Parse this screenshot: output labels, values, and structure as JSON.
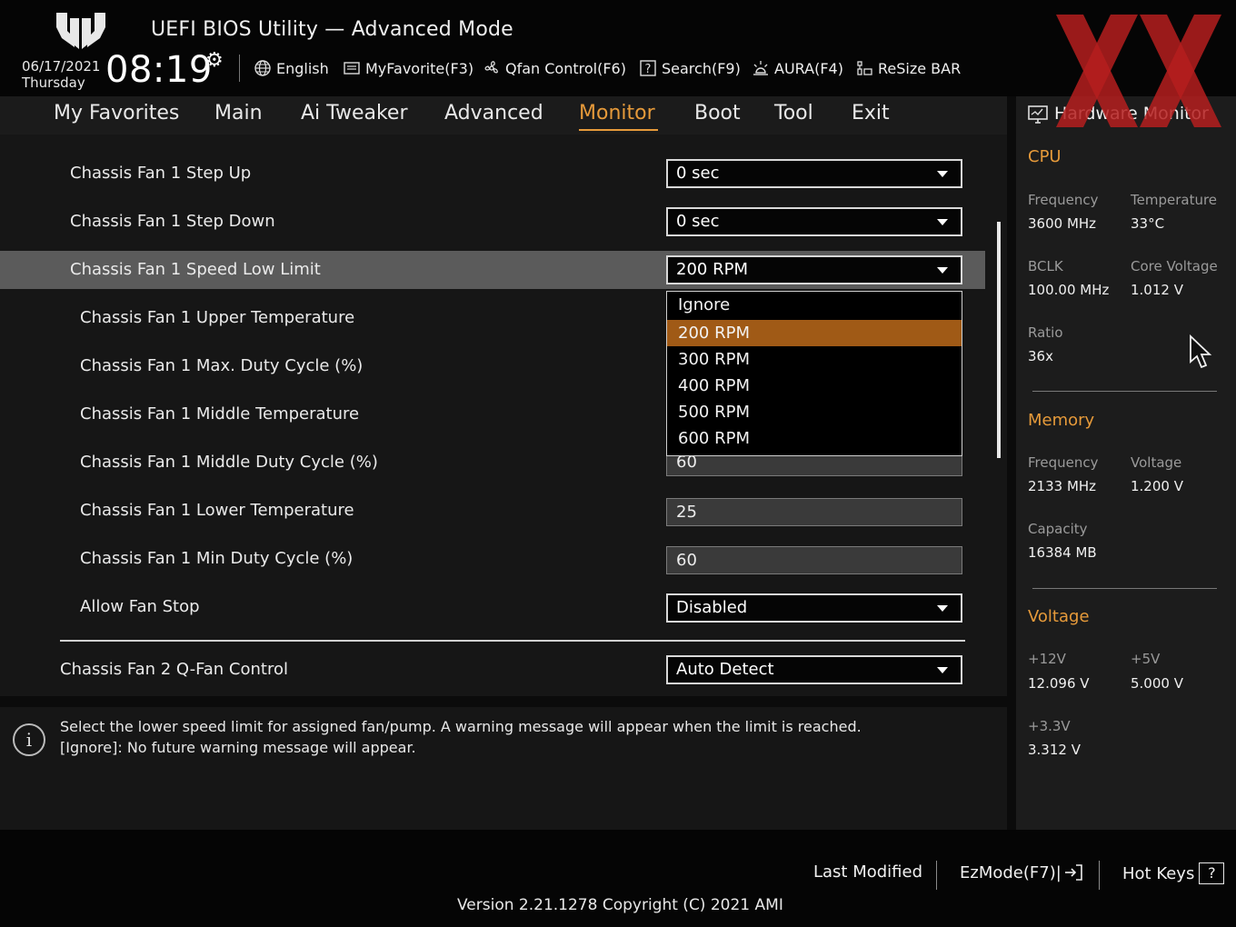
{
  "header": {
    "title": "UEFI BIOS Utility — Advanced Mode",
    "date": "06/17/2021",
    "day": "Thursday",
    "time": "08:19",
    "tools": [
      {
        "label": "English",
        "icon": "globe-icon"
      },
      {
        "label": "MyFavorite(F3)",
        "icon": "favorite-icon"
      },
      {
        "label": "Qfan Control(F6)",
        "icon": "fan-icon"
      },
      {
        "label": "Search(F9)",
        "icon": "help-search-icon"
      },
      {
        "label": "AURA(F4)",
        "icon": "aura-light-icon"
      },
      {
        "label": "ReSize BAR",
        "icon": "resize-bar-icon"
      }
    ]
  },
  "tabs": [
    {
      "label": "My Favorites",
      "active": false
    },
    {
      "label": "Main",
      "active": false
    },
    {
      "label": "Ai Tweaker",
      "active": false
    },
    {
      "label": "Advanced",
      "active": false
    },
    {
      "label": "Monitor",
      "active": true
    },
    {
      "label": "Boot",
      "active": false
    },
    {
      "label": "Tool",
      "active": false
    },
    {
      "label": "Exit",
      "active": false
    }
  ],
  "settings": [
    {
      "label": "Chassis Fan 1 Step Up",
      "value": "0 sec",
      "kind": "dropdown"
    },
    {
      "label": "Chassis Fan 1 Step Down",
      "value": "0 sec",
      "kind": "dropdown"
    },
    {
      "label": "Chassis Fan 1 Speed Low Limit",
      "value": "200 RPM",
      "kind": "dropdown",
      "highlighted": true
    },
    {
      "label": "Chassis Fan 1 Upper Temperature",
      "value": "",
      "kind": "field"
    },
    {
      "label": "Chassis Fan 1 Max. Duty Cycle (%)",
      "value": "",
      "kind": "field"
    },
    {
      "label": "Chassis Fan 1 Middle Temperature",
      "value": "",
      "kind": "field"
    },
    {
      "label": "Chassis Fan 1 Middle Duty Cycle (%)",
      "value": "60",
      "kind": "field"
    },
    {
      "label": "Chassis Fan 1 Lower Temperature",
      "value": "25",
      "kind": "field"
    },
    {
      "label": "Chassis Fan 1 Min Duty Cycle (%)",
      "value": "60",
      "kind": "field"
    },
    {
      "label": "Allow Fan Stop",
      "value": "Disabled",
      "kind": "dropdown"
    },
    {
      "label": "Chassis Fan 2 Q-Fan Control",
      "value": "Auto Detect",
      "kind": "dropdown"
    }
  ],
  "dropdown_options": [
    "Ignore",
    "200 RPM",
    "300 RPM",
    "400 RPM",
    "500 RPM",
    "600 RPM"
  ],
  "dropdown_selected": "200 RPM",
  "help": {
    "line1": "Select the lower speed limit for assigned fan/pump. A warning message will appear when the limit is reached.",
    "line2": "[Ignore]: No future warning message will appear."
  },
  "hardware_monitor": {
    "title": "Hardware Monitor",
    "cpu": {
      "heading": "CPU",
      "frequency_label": "Frequency",
      "frequency": "3600 MHz",
      "temperature_label": "Temperature",
      "temperature": "33°C",
      "bclk_label": "BCLK",
      "bclk": "100.00 MHz",
      "core_voltage_label": "Core Voltage",
      "core_voltage": "1.012 V",
      "ratio_label": "Ratio",
      "ratio": "36x"
    },
    "memory": {
      "heading": "Memory",
      "frequency_label": "Frequency",
      "frequency": "2133 MHz",
      "voltage_label": "Voltage",
      "voltage": "1.200 V",
      "capacity_label": "Capacity",
      "capacity": "16384 MB"
    },
    "voltage": {
      "heading": "Voltage",
      "v12_label": "+12V",
      "v12": "12.096 V",
      "v5_label": "+5V",
      "v5": "5.000 V",
      "v33_label": "+3.3V",
      "v33": "3.312 V"
    }
  },
  "footer": {
    "last_modified": "Last Modified",
    "ezmode": "EzMode(F7)|",
    "hotkeys": "Hot Keys",
    "hotkeys_symbol": "?",
    "version": "Version 2.21.1278 Copyright (C) 2021 AMI"
  },
  "colors": {
    "accent": "#e69a3a",
    "selected_option": "#a05a16",
    "highlight_row": "#5b5b5b"
  }
}
